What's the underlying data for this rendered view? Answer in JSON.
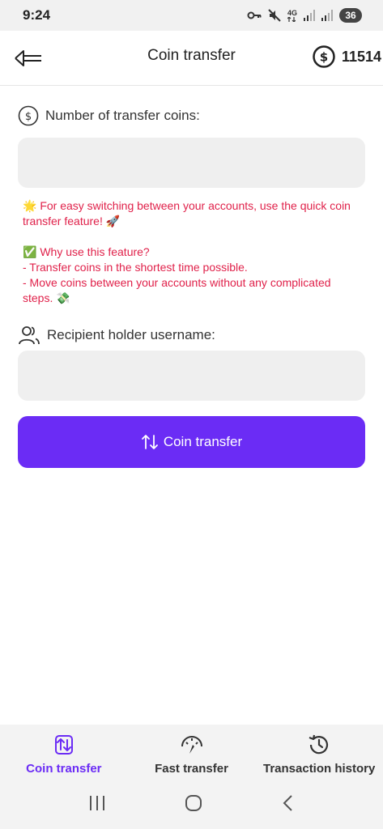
{
  "status_bar": {
    "time": "9:24",
    "network": "4G",
    "battery": "36"
  },
  "header": {
    "title": "Coin transfer",
    "balance": "11514"
  },
  "form": {
    "amount_label": "Number of transfer coins:",
    "amount_value": "",
    "info_intro": "🌟 For easy switching between your accounts, use the quick coin transfer feature! 🚀",
    "info_why": "✅ Why use this feature?",
    "info_point1": "- Transfer coins in  the shortest time possible.",
    "info_point2": "- Move coins between your accounts without any complicated steps. 💸",
    "recipient_label": "Recipient holder username:",
    "recipient_value": "",
    "submit_label": "Coin transfer"
  },
  "bottom_nav": {
    "items": [
      {
        "label": "Coin transfer",
        "icon": "transfer-arrows-icon",
        "active": true
      },
      {
        "label": "Fast transfer",
        "icon": "speedometer-icon",
        "active": false
      },
      {
        "label": "Transaction history",
        "icon": "history-icon",
        "active": false
      }
    ]
  },
  "colors": {
    "accent": "#6b2cf5",
    "info_text": "#e0214a",
    "field_bg": "#efefef"
  }
}
